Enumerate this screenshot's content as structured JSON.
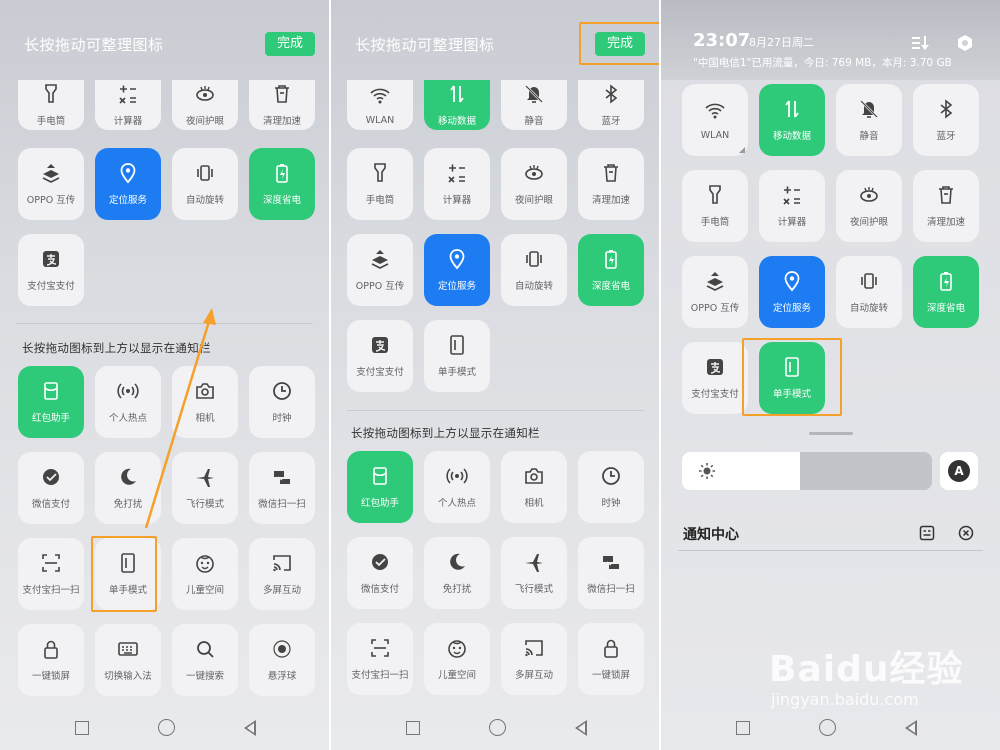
{
  "colors": {
    "green": "#2fc97a",
    "blue": "#1d7cf2",
    "orange": "#f5a02a",
    "tile": "#f2f2f4"
  },
  "panel1": {
    "header": "长按拖动可整理图标",
    "done": "完成",
    "active_tiles": [
      {
        "label": "手电筒",
        "icon": "flashlight-icon"
      },
      {
        "label": "计算器",
        "icon": "calculator-icon"
      },
      {
        "label": "夜间护眼",
        "icon": "eye-icon"
      },
      {
        "label": "清理加速",
        "icon": "trash-icon"
      },
      {
        "label": "OPPO 互传",
        "icon": "share-icon"
      },
      {
        "label": "定位服务",
        "icon": "location-icon",
        "on": "blue"
      },
      {
        "label": "自动旋转",
        "icon": "rotate-icon"
      },
      {
        "label": "深度省电",
        "icon": "battery-icon",
        "on": "green"
      },
      {
        "label": "支付宝支付",
        "icon": "alipay-icon"
      }
    ],
    "section": "长按拖动图标到上方以显示在通知栏",
    "available_tiles": [
      {
        "label": "红包助手",
        "icon": "redpacket-icon",
        "on": "green"
      },
      {
        "label": "个人热点",
        "icon": "hotspot-icon"
      },
      {
        "label": "相机",
        "icon": "camera-icon"
      },
      {
        "label": "时钟",
        "icon": "clock-icon"
      },
      {
        "label": "微信支付",
        "icon": "wechatpay-icon"
      },
      {
        "label": "免打扰",
        "icon": "moon-icon"
      },
      {
        "label": "飞行模式",
        "icon": "airplane-icon"
      },
      {
        "label": "微信扫一扫",
        "icon": "scan-icon"
      },
      {
        "label": "支付宝扫一扫",
        "icon": "scan-frame-icon"
      },
      {
        "label": "单手模式",
        "icon": "onehand-icon"
      },
      {
        "label": "儿童空间",
        "icon": "kid-icon"
      },
      {
        "label": "多屏互动",
        "icon": "cast-icon"
      },
      {
        "label": "一键锁屏",
        "icon": "lock-icon"
      },
      {
        "label": "切换输入法",
        "icon": "keyboard-icon"
      },
      {
        "label": "一键搜索",
        "icon": "search-icon"
      },
      {
        "label": "悬浮球",
        "icon": "ball-icon"
      }
    ]
  },
  "panel2": {
    "header": "长按拖动可整理图标",
    "done": "完成",
    "active_tiles": [
      {
        "label": "WLAN",
        "icon": "wifi-icon"
      },
      {
        "label": "移动数据",
        "icon": "data-icon",
        "on": "green"
      },
      {
        "label": "静音",
        "icon": "mute-icon"
      },
      {
        "label": "蓝牙",
        "icon": "bluetooth-icon"
      },
      {
        "label": "手电筒",
        "icon": "flashlight-icon"
      },
      {
        "label": "计算器",
        "icon": "calculator-icon"
      },
      {
        "label": "夜间护眼",
        "icon": "eye-icon"
      },
      {
        "label": "清理加速",
        "icon": "trash-icon"
      },
      {
        "label": "OPPO 互传",
        "icon": "share-icon"
      },
      {
        "label": "定位服务",
        "icon": "location-icon",
        "on": "blue"
      },
      {
        "label": "自动旋转",
        "icon": "rotate-icon"
      },
      {
        "label": "深度省电",
        "icon": "battery-icon",
        "on": "green"
      },
      {
        "label": "支付宝支付",
        "icon": "alipay-icon"
      },
      {
        "label": "单手模式",
        "icon": "onehand-icon"
      }
    ],
    "section": "长按拖动图标到上方以显示在通知栏",
    "available_tiles": [
      {
        "label": "红包助手",
        "icon": "redpacket-icon",
        "on": "green"
      },
      {
        "label": "个人热点",
        "icon": "hotspot-icon"
      },
      {
        "label": "相机",
        "icon": "camera-icon"
      },
      {
        "label": "时钟",
        "icon": "clock-icon"
      },
      {
        "label": "微信支付",
        "icon": "wechatpay-icon"
      },
      {
        "label": "免打扰",
        "icon": "moon-icon"
      },
      {
        "label": "飞行模式",
        "icon": "airplane-icon"
      },
      {
        "label": "微信扫一扫",
        "icon": "scan-icon"
      },
      {
        "label": "支付宝扫一扫",
        "icon": "scan-frame-icon"
      },
      {
        "label": "儿童空间",
        "icon": "kid-icon"
      },
      {
        "label": "多屏互动",
        "icon": "cast-icon"
      },
      {
        "label": "一键锁屏",
        "icon": "lock-icon"
      }
    ]
  },
  "panel3": {
    "time": "23:07",
    "date": "8月27日周二",
    "carrier": "\"中国电信1\"已用流量，今日: 769 MB，本月: 3.70 GB",
    "tiles": [
      {
        "label": "WLAN",
        "icon": "wifi-icon"
      },
      {
        "label": "移动数据",
        "icon": "data-icon",
        "on": "green"
      },
      {
        "label": "静音",
        "icon": "mute-icon"
      },
      {
        "label": "蓝牙",
        "icon": "bluetooth-icon"
      },
      {
        "label": "手电筒",
        "icon": "flashlight-icon"
      },
      {
        "label": "计算器",
        "icon": "calculator-icon"
      },
      {
        "label": "夜间护眼",
        "icon": "eye-icon"
      },
      {
        "label": "清理加速",
        "icon": "trash-icon"
      },
      {
        "label": "OPPO 互传",
        "icon": "share-icon"
      },
      {
        "label": "定位服务",
        "icon": "location-icon",
        "on": "blue"
      },
      {
        "label": "自动旋转",
        "icon": "rotate-icon"
      },
      {
        "label": "深度省电",
        "icon": "battery-icon",
        "on": "green"
      },
      {
        "label": "支付宝支付",
        "icon": "alipay-icon"
      },
      {
        "label": "单手模式",
        "icon": "onehand-icon",
        "on": "green"
      }
    ],
    "brightness": 0.47,
    "auto_brightness": "A",
    "notification_title": "通知中心"
  },
  "watermark": {
    "logo": "Baidu经验",
    "url": "jingyan.baidu.com"
  }
}
